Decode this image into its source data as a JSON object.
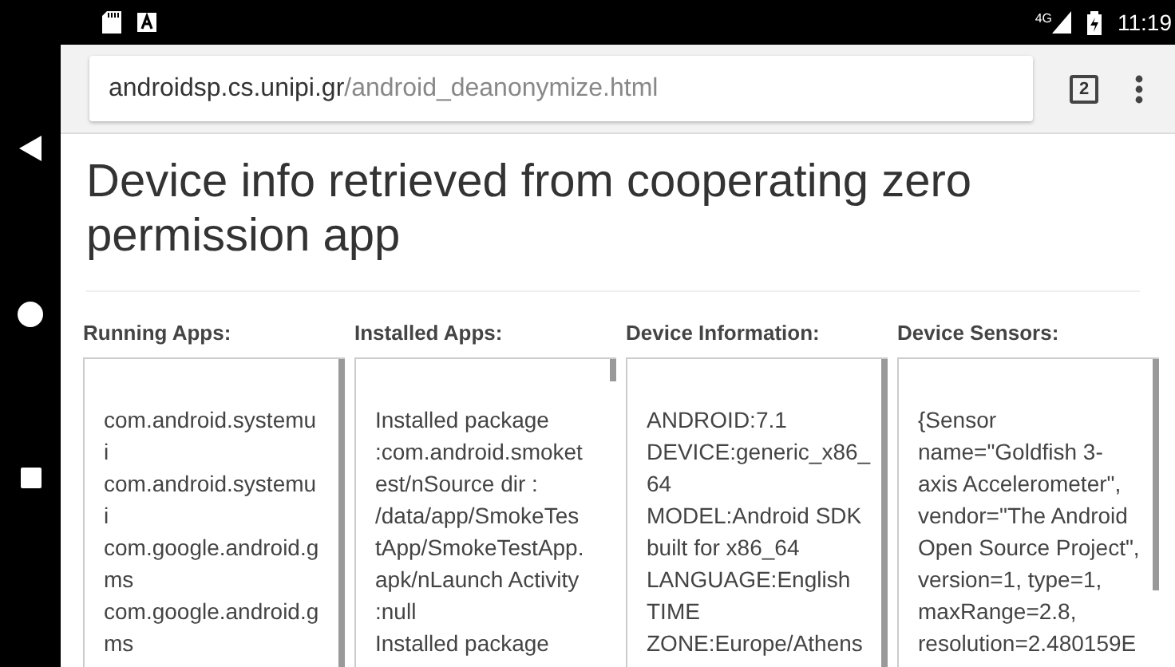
{
  "status_bar": {
    "network": "4G",
    "time": "11:19"
  },
  "address_bar": {
    "host": "androidsp.cs.unipi.gr",
    "path": "/android_deanonymize.html",
    "tab_count": "2"
  },
  "heading": "Device info retrieved from cooperating zero permission app",
  "columns": [
    {
      "title": "Running Apps:",
      "lines": [
        "com.android.systemu",
        "i",
        "com.android.systemu",
        "i",
        "com.google.android.g",
        "ms",
        "com.google.android.g",
        "ms"
      ]
    },
    {
      "title": "Installed Apps:",
      "lines": [
        "Installed package",
        ":com.android.smoket",
        "est/nSource dir :",
        "/data/app/SmokeTes",
        "tApp/SmokeTestApp.",
        "apk/nLaunch Activity",
        ":null",
        "Installed package"
      ]
    },
    {
      "title": "Device Information:",
      "lines": [
        "ANDROID:7.1",
        "DEVICE:generic_x86_",
        "64",
        "MODEL:Android SDK",
        "built for x86_64",
        "LANGUAGE:English",
        "TIME",
        "ZONE:Europe/Athens"
      ]
    },
    {
      "title": "Device Sensors:",
      "lines": [
        "{Sensor",
        "name=\"Goldfish 3-",
        "axis Accelerometer\",",
        "vendor=\"The Android",
        "Open Source Project\",",
        "version=1, type=1,",
        "maxRange=2.8,",
        "resolution=2.480159E"
      ]
    }
  ]
}
